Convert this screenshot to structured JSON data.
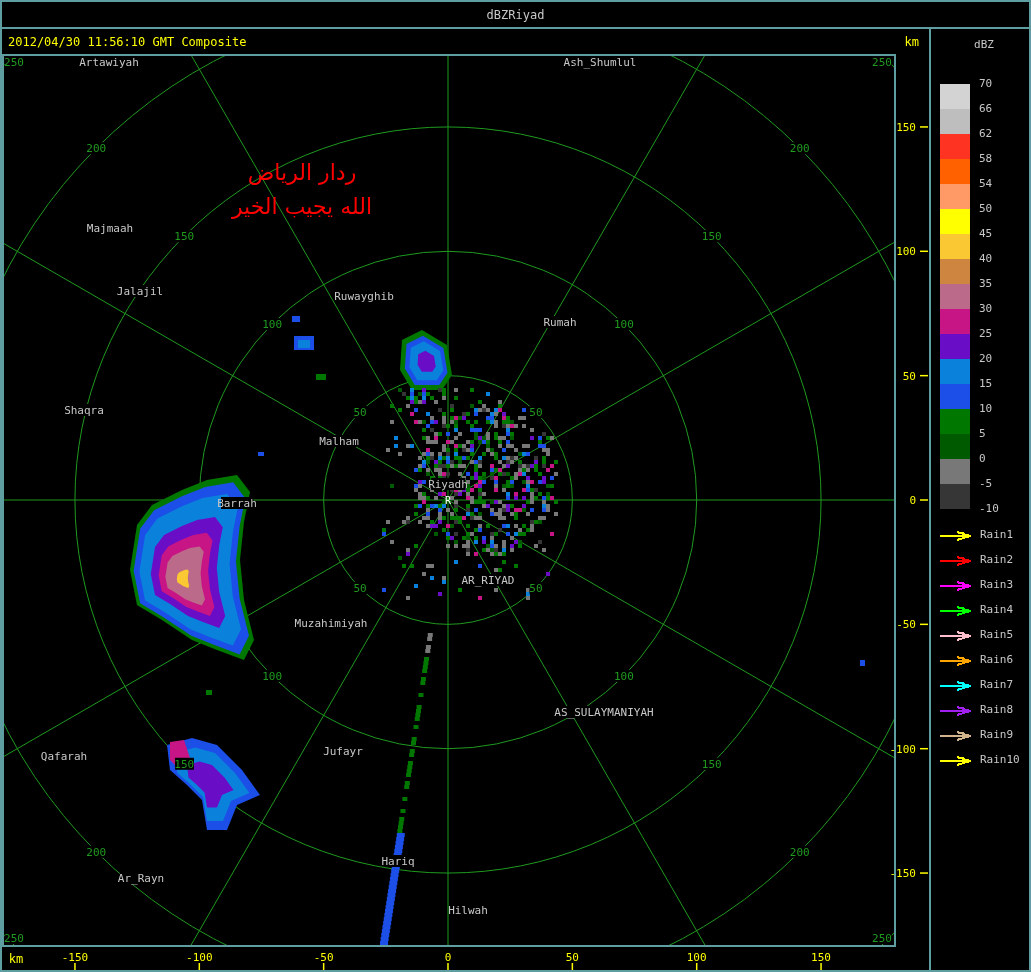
{
  "window": {
    "title": "dBZRiyad"
  },
  "header": {
    "timestamp": "2012/04/30 11:56:10 GMT Composite",
    "unit": "km"
  },
  "annotation": {
    "lines": [
      "ردار الرياض",
      "الله يجيب الخير"
    ]
  },
  "radar": {
    "site_marker": "R",
    "places": [
      "Artawiyah",
      "Ash_Shumlul",
      "Majmaah",
      "Jalajil",
      "Ruwayghib",
      "Rumah",
      "Shaqra",
      "Malham",
      "Riyadh",
      "Barrah",
      "AR_RIYAD",
      "Muzahimiyah",
      "AS_SULAYMANIYAH",
      "Qafarah",
      "Jufayr",
      "Hariq",
      "Ar_Rayn",
      "Hilwah"
    ],
    "range_rings": [
      {
        "labels": [
          "50",
          "50",
          "50",
          "50"
        ]
      },
      {
        "labels": [
          "100",
          "100",
          "100",
          "100"
        ]
      },
      {
        "labels": [
          "150",
          "150",
          "150",
          "150"
        ]
      },
      {
        "labels": [
          "200",
          "200",
          "200",
          "200"
        ]
      },
      {
        "labels": [
          "250",
          "250",
          "250",
          "250"
        ]
      }
    ]
  },
  "x_axis": {
    "unit": "km",
    "ticks": [
      "-150",
      "-100",
      "-50",
      "0",
      "50",
      "100",
      "150"
    ]
  },
  "y_axis": {
    "ticks": [
      "150",
      "100",
      "50",
      "0",
      "-50",
      "-100",
      "-150"
    ]
  },
  "legend": {
    "title": "dBZ",
    "ticks": [
      "70",
      "66",
      "62",
      "58",
      "54",
      "50",
      "45",
      "40",
      "35",
      "30",
      "25",
      "20",
      "15",
      "10",
      "5",
      "0",
      "-5",
      "-10"
    ],
    "bins": [
      {
        "color": "#d3d3d3"
      },
      {
        "color": "#bebebe"
      },
      {
        "color": "#ff3322"
      },
      {
        "color": "#ff6000"
      },
      {
        "color": "#ff9966"
      },
      {
        "color": "#ffff00"
      },
      {
        "color": "#fac832"
      },
      {
        "color": "#cd853f"
      },
      {
        "color": "#bc6a8a"
      },
      {
        "color": "#c71585"
      },
      {
        "color": "#6a0dc6"
      },
      {
        "color": "#0a82dc"
      },
      {
        "color": "#1c4ee8"
      },
      {
        "color": "#007800"
      },
      {
        "color": "#005a00"
      },
      {
        "color": "#787878"
      },
      {
        "color": "#363636"
      }
    ]
  },
  "tracks": [
    {
      "label": "Rain1",
      "color": "#ffff00"
    },
    {
      "label": "Rain2",
      "color": "#ff0000"
    },
    {
      "label": "Rain3",
      "color": "#ff00ff"
    },
    {
      "label": "Rain4",
      "color": "#00ff00"
    },
    {
      "label": "Rain5",
      "color": "#ffc0cb"
    },
    {
      "label": "Rain6",
      "color": "#ffa500"
    },
    {
      "label": "Rain7",
      "color": "#00ffff"
    },
    {
      "label": "Rain8",
      "color": "#a020f0"
    },
    {
      "label": "Rain9",
      "color": "#d2b48c"
    },
    {
      "label": "Rain10",
      "color": "#ffff00"
    }
  ]
}
